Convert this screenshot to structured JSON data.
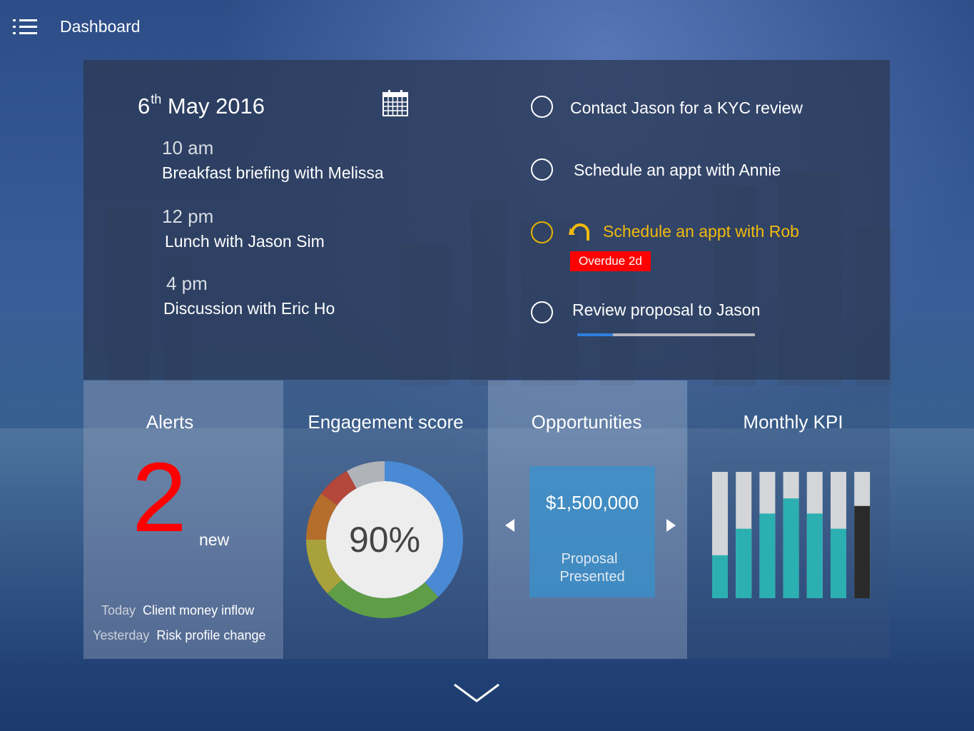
{
  "header": {
    "title": "Dashboard",
    "menu_icon": "hamburger-list-icon"
  },
  "agenda": {
    "date_day": "6",
    "date_suffix": "th",
    "date_rest": "May 2016",
    "calendar_icon": "calendar-icon",
    "events": [
      {
        "time": "10 am",
        "description": "Breakfast briefing with Melissa"
      },
      {
        "time": "12 pm",
        "description": "Lunch with Jason Sim"
      },
      {
        "time": "4 pm",
        "description": "Discussion with Eric Ho"
      }
    ]
  },
  "tasks": [
    {
      "label": "Contact Jason for a KYC review",
      "status": "open"
    },
    {
      "label": "Schedule an appt with Annie",
      "status": "open"
    },
    {
      "label": "Schedule an appt with Rob",
      "status": "overdue",
      "badge": "Overdue 2d",
      "icon": "redo-icon",
      "color": "#f2b90c"
    },
    {
      "label": "Review proposal to Jason",
      "status": "open"
    }
  ],
  "tasks_scroll_fraction": 0.2,
  "alerts": {
    "title": "Alerts",
    "count": "2",
    "count_label": "new",
    "count_color": "#ff0000",
    "items": [
      {
        "when": "Today",
        "text": "Client money inflow"
      },
      {
        "when": "Yesterday",
        "text": "Risk profile change"
      }
    ]
  },
  "engagement": {
    "title": "Engagement score",
    "value_label": "90%",
    "segments": [
      {
        "color": "#4a8ad4",
        "fraction": 0.38
      },
      {
        "color": "#5f9e46",
        "fraction": 0.25
      },
      {
        "color": "#a9a13c",
        "fraction": 0.12
      },
      {
        "color": "#b46d2a",
        "fraction": 0.1
      },
      {
        "color": "#b4463a",
        "fraction": 0.07
      },
      {
        "color": "#b0b3b8",
        "fraction": 0.08
      }
    ]
  },
  "opportunities": {
    "title": "Opportunities",
    "amount": "$1,500,000",
    "stage_line1": "Proposal",
    "stage_line2": "Presented"
  },
  "kpi": {
    "title": "Monthly KPI",
    "bars": [
      {
        "value": 0.34,
        "color": "#2bafb0"
      },
      {
        "value": 0.55,
        "color": "#2bafb0"
      },
      {
        "value": 0.67,
        "color": "#2bafb0"
      },
      {
        "value": 0.79,
        "color": "#2bafb0"
      },
      {
        "value": 0.67,
        "color": "#2bafb0"
      },
      {
        "value": 0.55,
        "color": "#2bafb0"
      },
      {
        "value": 0.73,
        "color": "#2a2a2a"
      }
    ],
    "track_color": "#d3d5d8"
  },
  "scroll_down_icon": "chevron-down-icon"
}
